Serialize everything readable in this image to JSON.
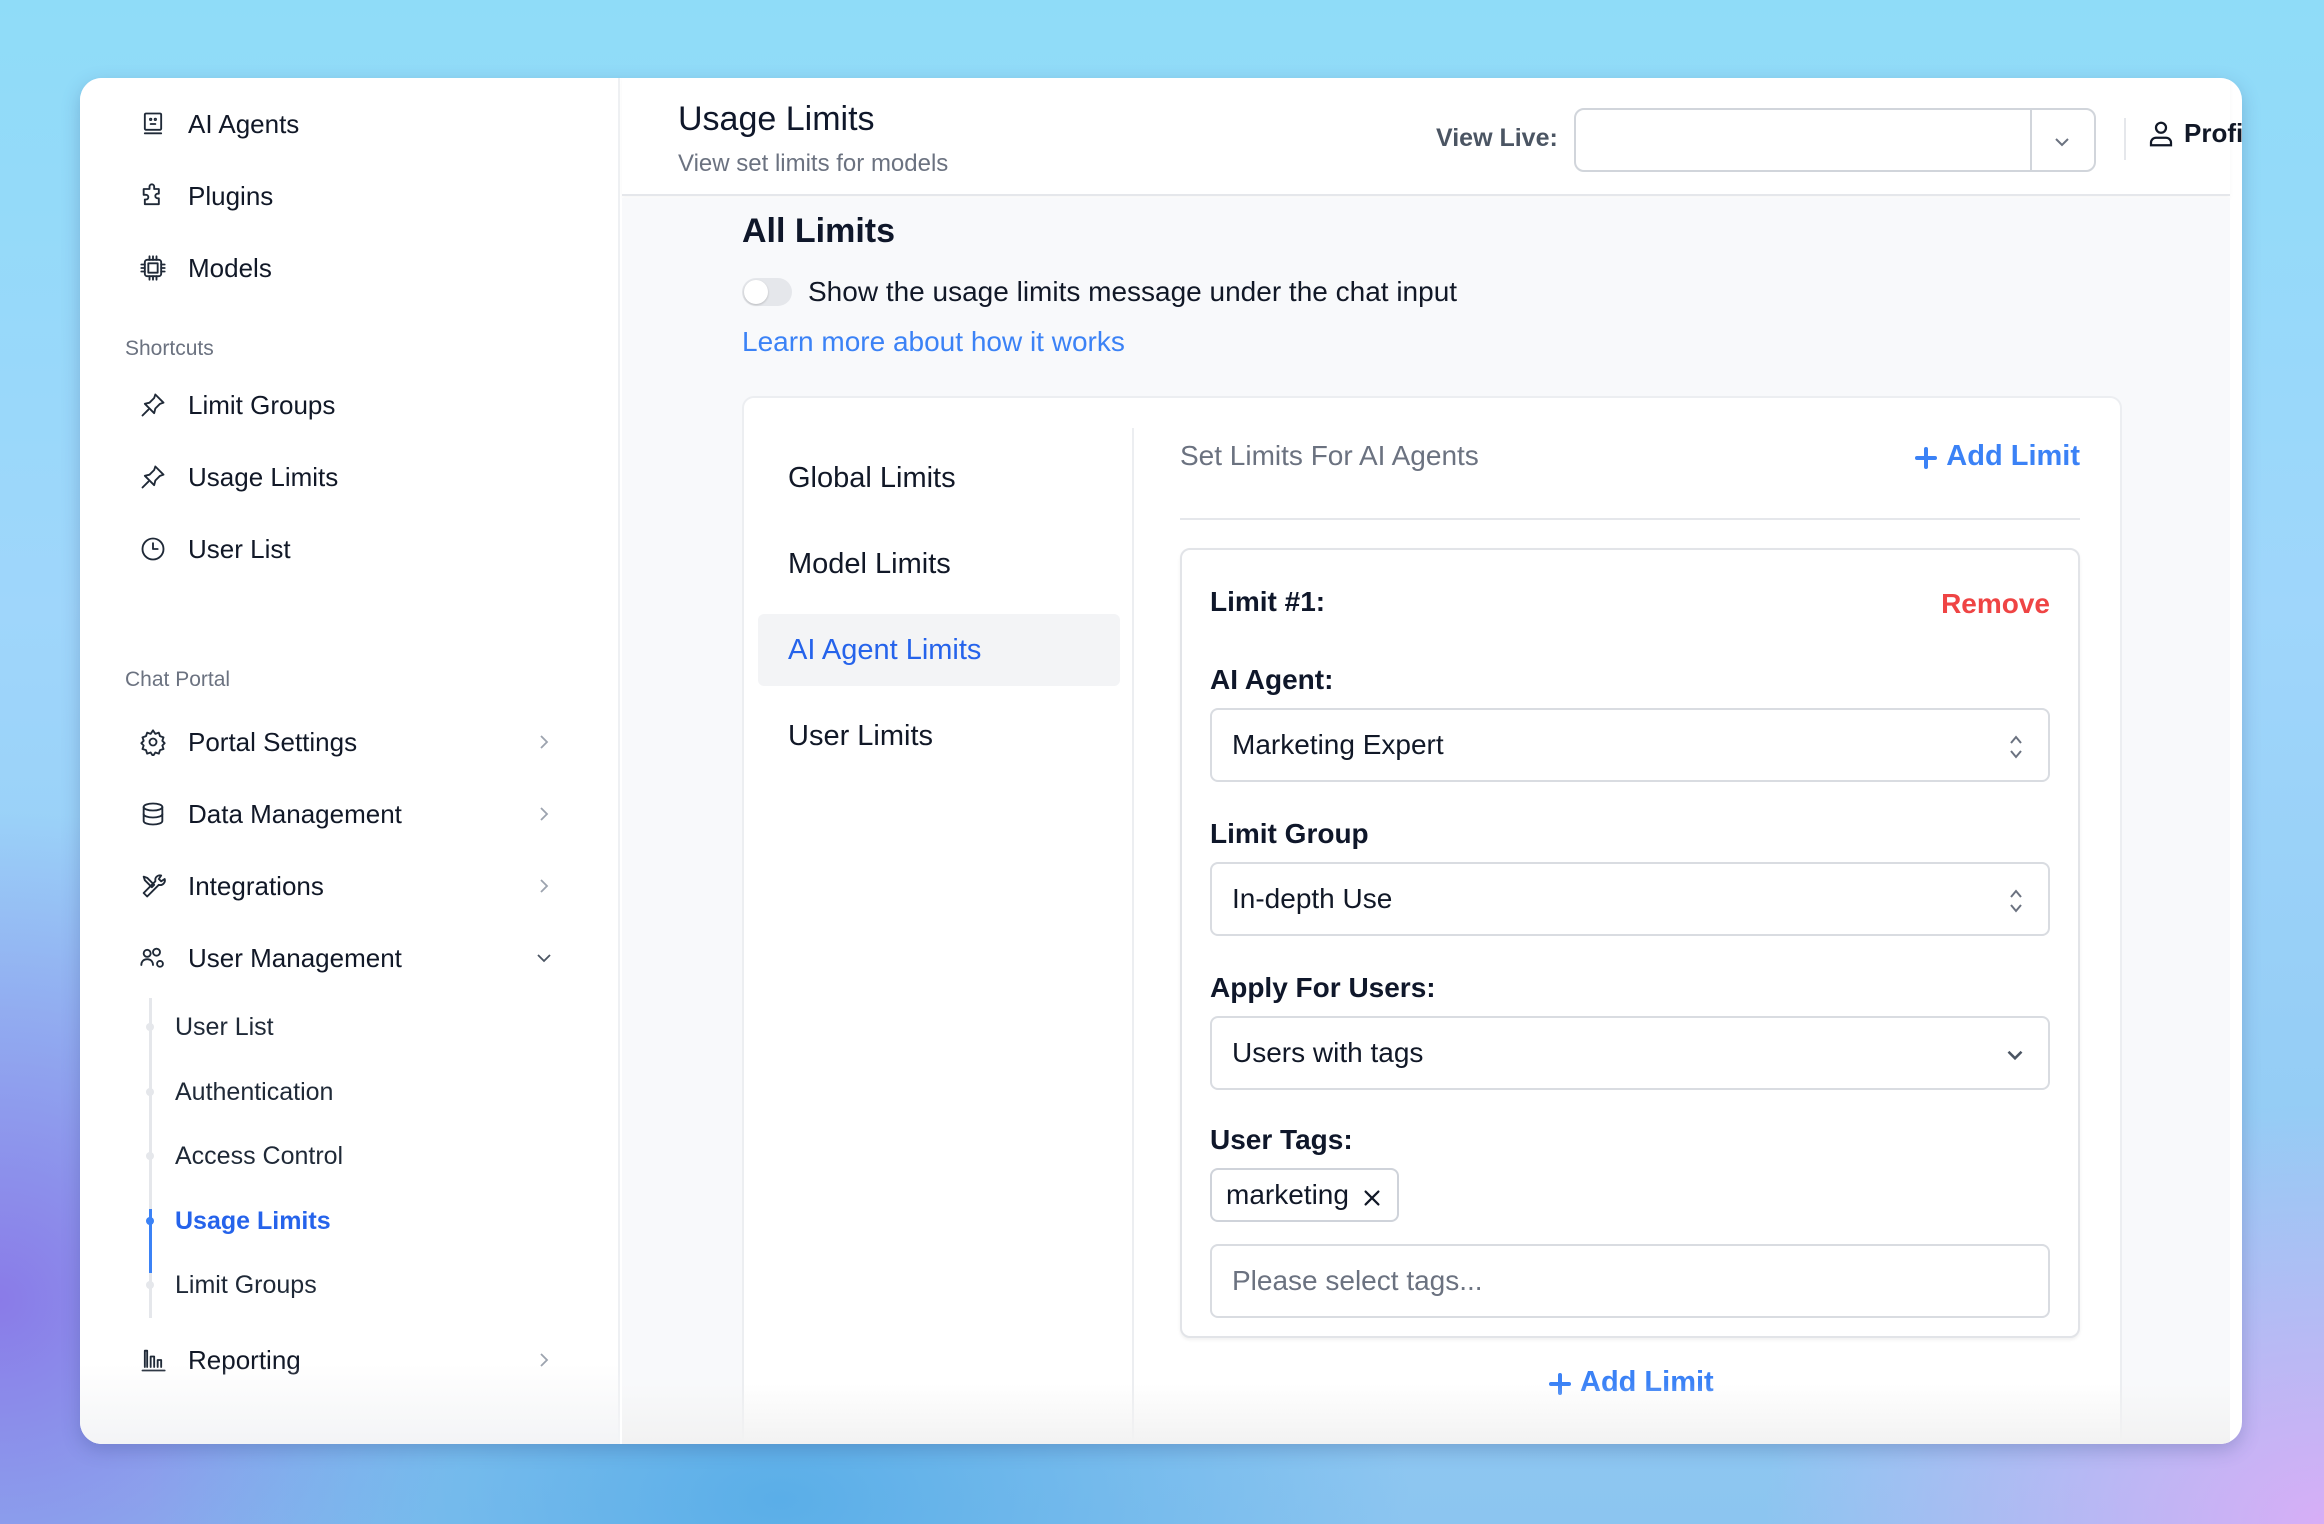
{
  "sidebar": {
    "top_items": [
      {
        "label": "AI Agents",
        "icon": "robot-icon"
      },
      {
        "label": "Plugins",
        "icon": "puzzle-icon"
      },
      {
        "label": "Models",
        "icon": "chip-icon"
      }
    ],
    "shortcuts_label": "Shortcuts",
    "shortcuts": [
      {
        "label": "Limit Groups",
        "icon": "pin-icon"
      },
      {
        "label": "Usage Limits",
        "icon": "pin-icon"
      },
      {
        "label": "User List",
        "icon": "clock-icon"
      }
    ],
    "chat_portal_label": "Chat Portal",
    "chat_portal_items": [
      {
        "label": "Portal Settings",
        "icon": "gear-icon",
        "expanded": false
      },
      {
        "label": "Data Management",
        "icon": "database-icon",
        "expanded": false
      },
      {
        "label": "Integrations",
        "icon": "tools-icon",
        "expanded": false
      },
      {
        "label": "User Management",
        "icon": "users-gear-icon",
        "expanded": true
      }
    ],
    "user_management_sub": [
      {
        "label": "User List",
        "active": false
      },
      {
        "label": "Authentication",
        "active": false
      },
      {
        "label": "Access Control",
        "active": false
      },
      {
        "label": "Usage Limits",
        "active": true
      },
      {
        "label": "Limit Groups",
        "active": false
      }
    ],
    "reporting": {
      "label": "Reporting",
      "icon": "bar-chart-icon",
      "expanded": false
    }
  },
  "header": {
    "title": "Usage Limits",
    "subtitle": "View set limits for models",
    "view_live_label": "View Live:",
    "view_live_value": "",
    "profile_label": "Profile"
  },
  "main": {
    "section_title": "All Limits",
    "toggle_label": "Show the usage limits message under the chat input",
    "toggle_on": false,
    "learn_more": "Learn more about how it works",
    "tabs": [
      {
        "label": "Global Limits",
        "active": false
      },
      {
        "label": "Model Limits",
        "active": false
      },
      {
        "label": "AI Agent Limits",
        "active": true
      },
      {
        "label": "User Limits",
        "active": false
      }
    ],
    "panel": {
      "title": "Set Limits For AI Agents",
      "add_limit": "Add Limit",
      "limit": {
        "title": "Limit #1:",
        "remove": "Remove",
        "ai_agent_label": "AI Agent:",
        "ai_agent_value": "Marketing Expert",
        "limit_group_label": "Limit Group",
        "limit_group_value": "In-depth Use",
        "apply_label": "Apply For Users:",
        "apply_value": "Users with tags",
        "user_tags_label": "User Tags:",
        "tags": [
          "marketing"
        ],
        "tags_placeholder": "Please select tags..."
      },
      "add_limit_bottom": "Add Limit"
    }
  },
  "colors": {
    "accent": "#3b82f6",
    "active_text": "#2563eb",
    "danger": "#ef4444",
    "muted": "#6b7280"
  }
}
